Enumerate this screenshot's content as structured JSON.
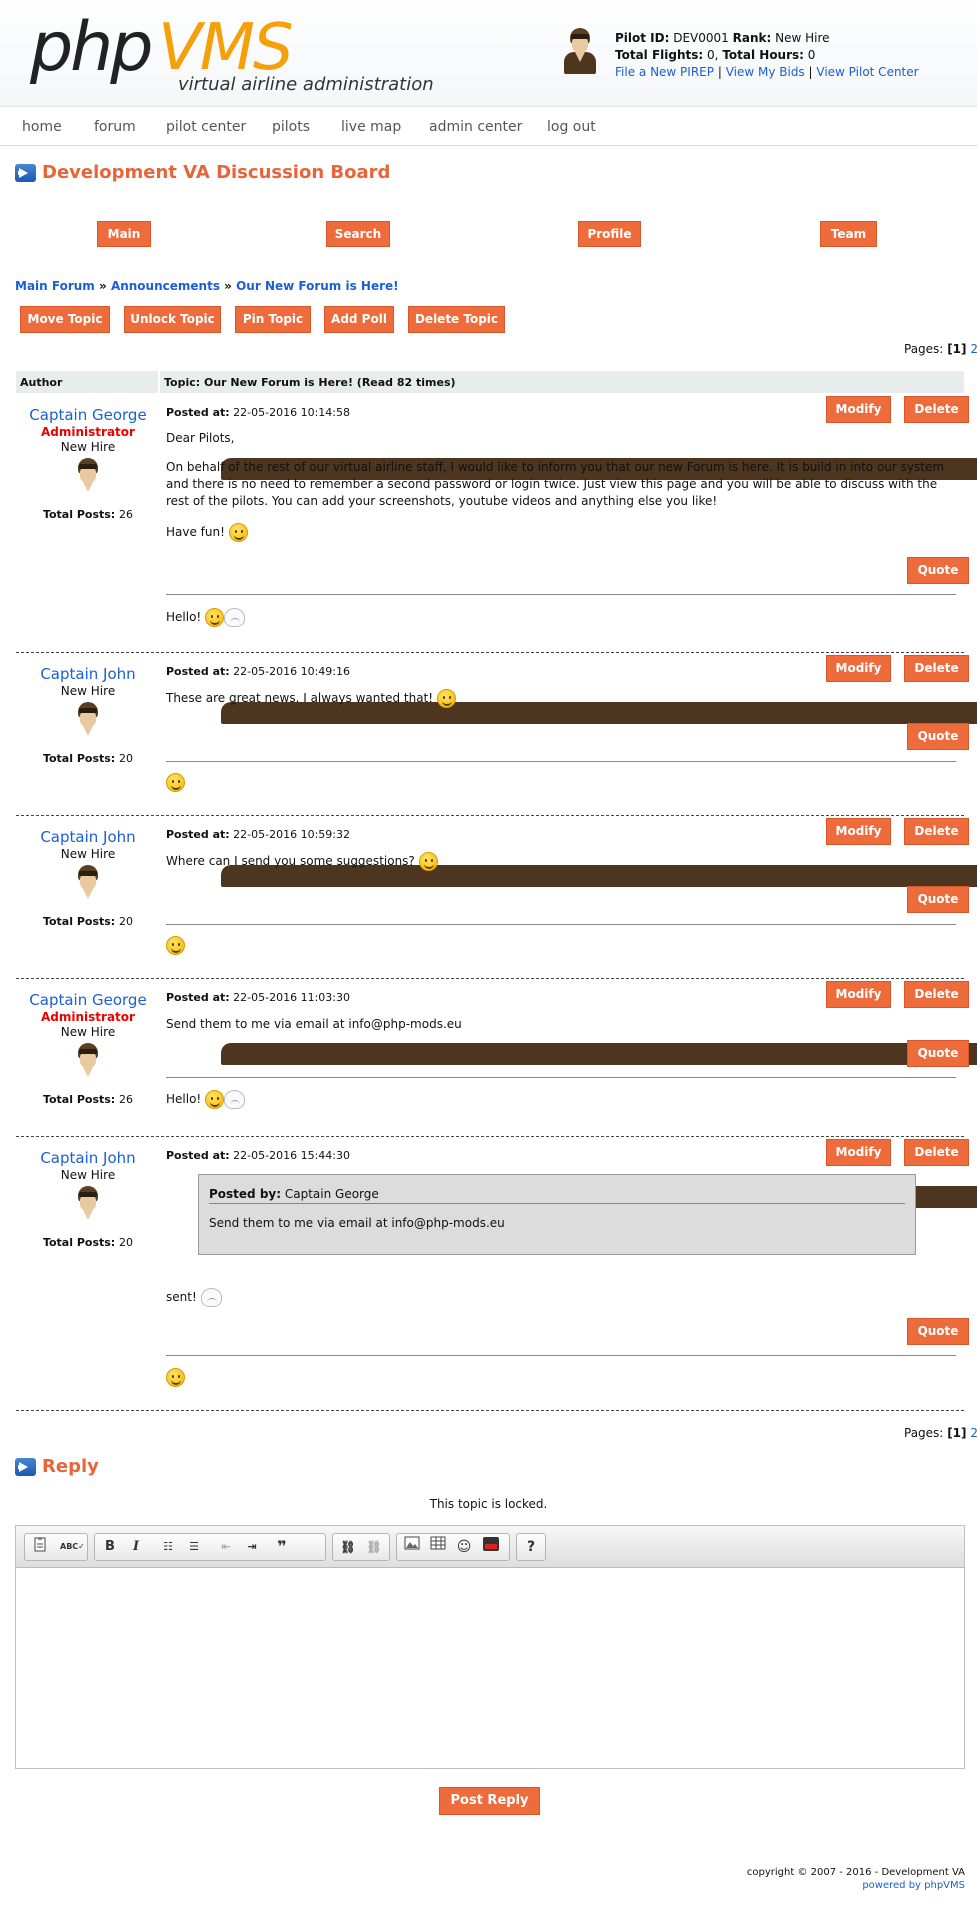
{
  "header": {
    "logo_php": "php",
    "logo_vms": "VMS",
    "logo_tagline": "virtual airline administration",
    "pilot_id_label": "Pilot ID:",
    "pilot_id": "DEV0001",
    "rank_label": "Rank:",
    "rank": "New Hire",
    "flights_label": "Total Flights:",
    "flights": "0,",
    "hours_label": "Total Hours:",
    "hours": "0",
    "link_pirep": "File a New PIREP",
    "link_bids": "View My Bids",
    "link_center": "View Pilot Center",
    "sep": "|"
  },
  "nav": {
    "home": "home",
    "forum": "forum",
    "pilot_center": "pilot center",
    "pilots": "pilots",
    "live_map": "live map",
    "admin_center": "admin center",
    "log_out": "log out"
  },
  "board": {
    "title": "Development VA Discussion Board",
    "main": "Main",
    "search": "Search",
    "profile": "Profile",
    "team": "Team"
  },
  "breadcrumb": {
    "main_forum": "Main Forum",
    "announcements": "Announcements",
    "topic": "Our New Forum is Here!",
    "sep": "»"
  },
  "actions": {
    "move": "Move Topic",
    "unlock": "Unlock Topic",
    "pin": "Pin Topic",
    "poll": "Add Poll",
    "delete": "Delete Topic"
  },
  "pages": {
    "label": "Pages:",
    "current": "[1]",
    "next": "2"
  },
  "table": {
    "author": "Author",
    "topic": "Topic: Our New Forum is Here! (Read 82 times)"
  },
  "labels": {
    "posted_at": "Posted at:",
    "total_posts": "Total Posts:",
    "modify": "Modify",
    "delete": "Delete",
    "quote": "Quote",
    "posted_by": "Posted by:"
  },
  "posts": [
    {
      "author": "Captain George",
      "role": "Administrator",
      "rank": "New Hire",
      "total": "26",
      "date": "22-05-2016 10:14:58",
      "p1": "Dear Pilots,",
      "p2": "On behalf of the rest of our virtual airline staff, I would like to inform you that our new Forum is here. It is build in into our system and there is no need to remember a second password or login twice. Just view this page and you will be able to discuss with the rest of the pilots. You can add your screenshots, youtube videos and anything else you like!",
      "p3": "Have fun!",
      "sig": "Hello!"
    },
    {
      "author": "Captain John",
      "rank": "New Hire",
      "total": "20",
      "date": "22-05-2016 10:49:16",
      "p1": "These are great news. I always wanted that!"
    },
    {
      "author": "Captain John",
      "rank": "New Hire",
      "total": "20",
      "date": "22-05-2016 10:59:32",
      "p1": "Where can I send you some suggestions?"
    },
    {
      "author": "Captain George",
      "role": "Administrator",
      "rank": "New Hire",
      "total": "26",
      "date": "22-05-2016 11:03:30",
      "p1": "Send them to me via email at info@php-mods.eu",
      "sig": "Hello!"
    },
    {
      "author": "Captain John",
      "rank": "New Hire",
      "total": "20",
      "date": "22-05-2016 15:44:30",
      "quote_author": "Captain George",
      "quote_text": "Send them to me via email at info@php-mods.eu",
      "p1": "sent!"
    }
  ],
  "reply": {
    "title": "Reply",
    "locked": "This topic is locked.",
    "post_button": "Post Reply",
    "tool_bold": "B",
    "tool_italic": "I",
    "tool_quote": "❞",
    "tool_help": "?"
  },
  "footer": {
    "copyright": "copyright © 2007 - 2016 - Development VA",
    "powered": "powered by phpVMS"
  },
  "colors": {
    "accent": "#ee6b3c",
    "link": "#1a5fd4",
    "admin": "#ee0000",
    "logo_orange": "#f5a00a"
  }
}
